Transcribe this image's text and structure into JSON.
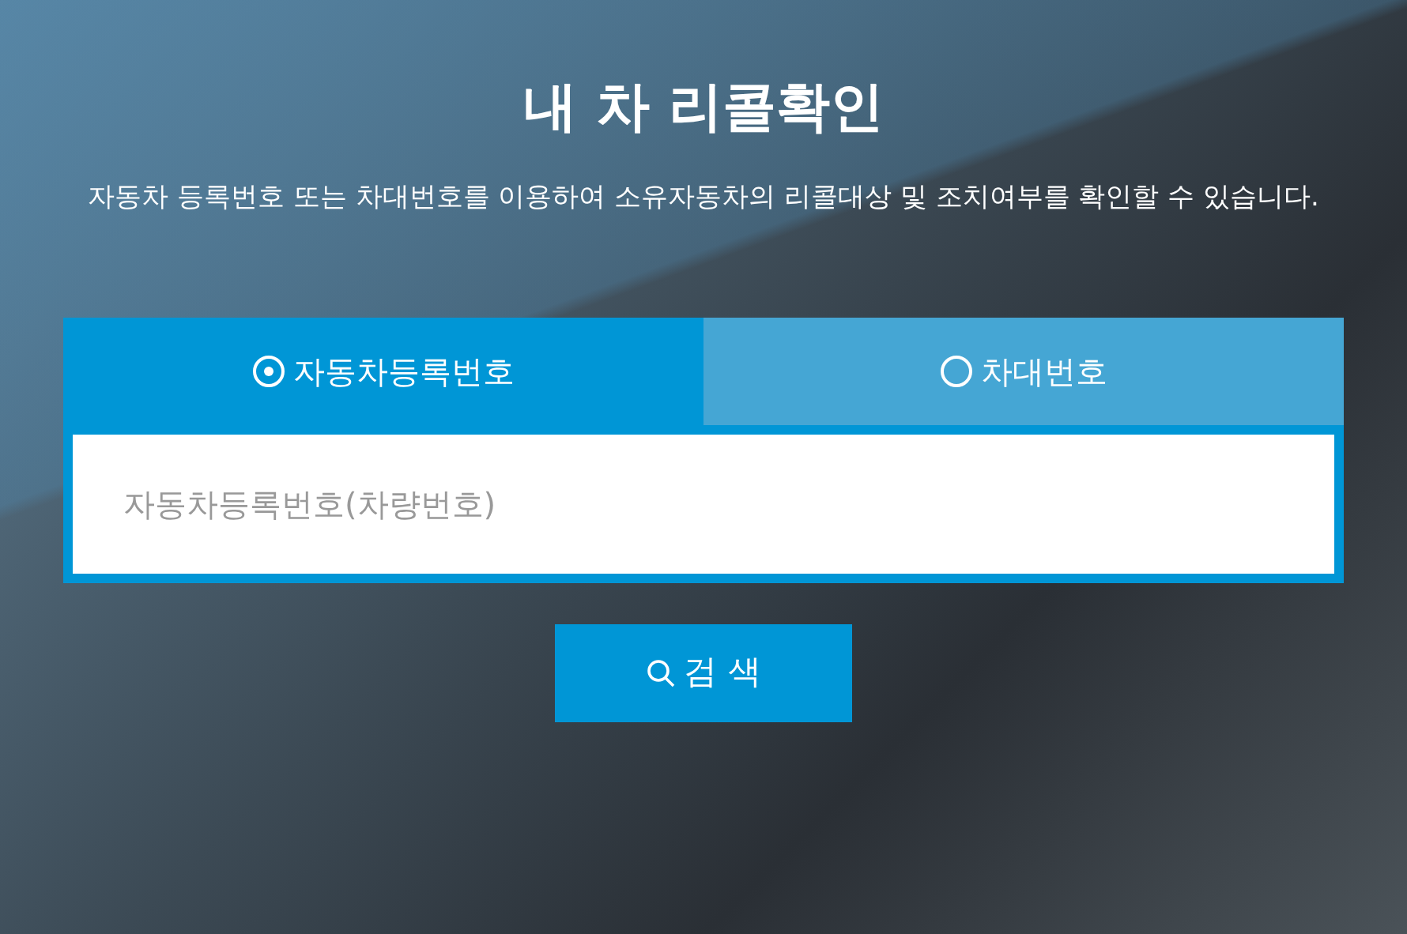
{
  "title": "내 차 리콜확인",
  "description": "자동차 등록번호 또는 차대번호를 이용하여 소유자동차의 리콜대상 및 조치여부를 확인할 수 있습니다.",
  "tabs": [
    {
      "label": "자동차등록번호",
      "selected": true
    },
    {
      "label": "차대번호",
      "selected": false
    }
  ],
  "search_field": {
    "placeholder": "자동차등록번호(차량번호)"
  },
  "search_button": {
    "label": "검 색"
  }
}
